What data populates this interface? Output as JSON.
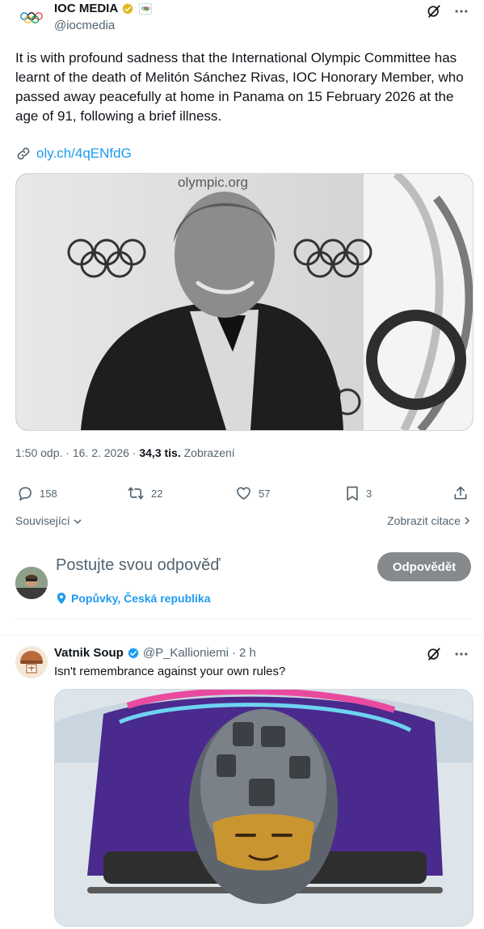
{
  "main_tweet": {
    "name": "IOC MEDIA",
    "handle": "@iocmedia",
    "text": "It is with profound sadness that the International Olympic Committee has learnt of the death of Melitón Sánchez Rivas, IOC Honorary Member, who passed away peacefully at home in Panama on 15 February 2026 at the age of 91, following a brief illness.",
    "link": "oly.ch/4qENfdG",
    "photo_watermark": "olympic.org",
    "time": "1:50 odp.",
    "date": "16. 2. 2026",
    "views_count": "34,3 tis.",
    "views_label": "Zobrazení",
    "stats": {
      "replies": "158",
      "reposts": "22",
      "likes": "57",
      "bookmarks": "3"
    },
    "related_label": "Související",
    "quotes_label": "Zobrazit citace"
  },
  "composer": {
    "placeholder": "Postujte svou odpověď",
    "reply_button": "Odpovědět",
    "location": "Popůvky, Česká republika"
  },
  "reply_tweet": {
    "name": "Vatnik Soup",
    "handle": "@P_Kallioniemi",
    "time": "2 h",
    "text": "Isn't remembrance against your own rules?"
  },
  "colors": {
    "accent": "#1d9bf0",
    "verified_gold": "#e2b719",
    "button_gray": "#878a8c"
  },
  "icons": [
    "olympic-rings-icon",
    "verified-badge-icon",
    "grok-icon",
    "more-icon",
    "link-icon",
    "reply-icon",
    "repost-icon",
    "like-icon",
    "bookmark-icon",
    "share-icon",
    "chevron-down-icon",
    "chevron-right-icon",
    "location-pin-icon"
  ]
}
